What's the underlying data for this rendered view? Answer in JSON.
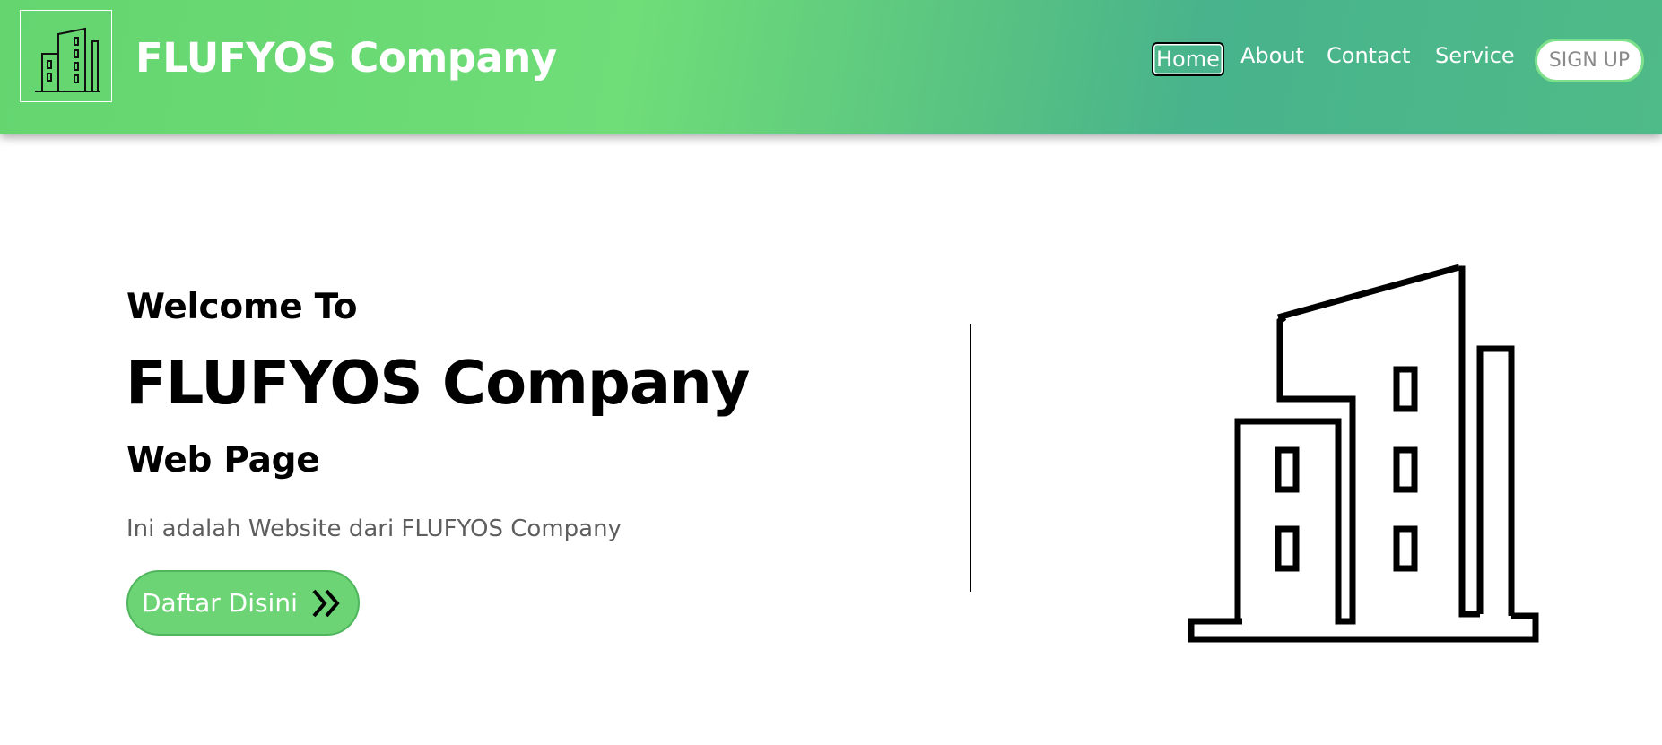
{
  "header": {
    "brand": "FLUFYOS Company",
    "logo_icon": "building-icon",
    "nav": [
      {
        "label": "Home",
        "active": true
      },
      {
        "label": "About"
      },
      {
        "label": "Contact"
      },
      {
        "label": "Service"
      }
    ],
    "signup_label": "SIGN UP"
  },
  "hero": {
    "welcome": "Welcome To",
    "title": "FLUFYOS Company",
    "subtitle": "Web Page",
    "description": "Ini adalah Website dari FLUFYOS Company",
    "cta_label": "Daftar Disini",
    "cta_icon": "chevrons-right-icon",
    "illustration_icon": "building-icon"
  },
  "colors": {
    "header_gradient_start": "#64d56f",
    "header_gradient_mid": "#48b38c",
    "cta_background": "#6cd474",
    "signup_border": "#7ee08a",
    "description_text": "#5e5e5e"
  }
}
